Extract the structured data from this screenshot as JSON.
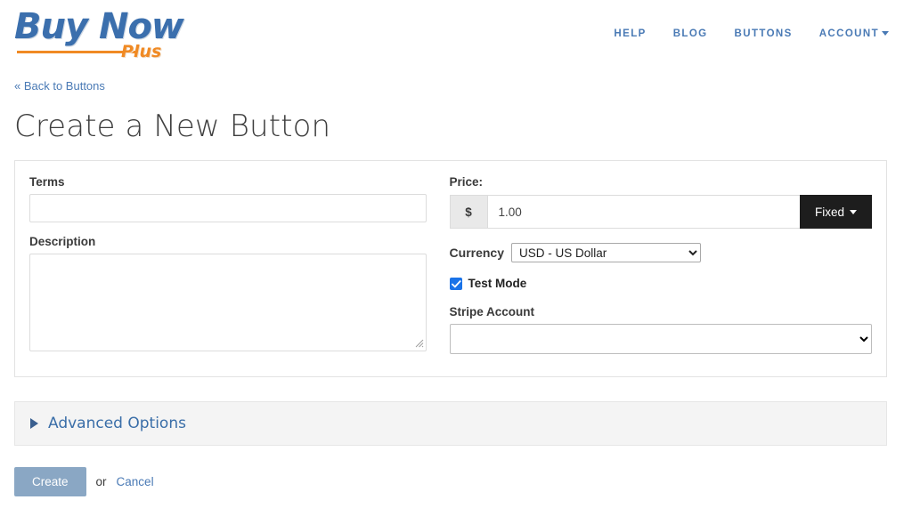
{
  "header": {
    "logo": {
      "main": "Buy Now",
      "sub": "Plus"
    },
    "nav": [
      {
        "label": "HELP",
        "has_caret": false
      },
      {
        "label": "BLOG",
        "has_caret": false
      },
      {
        "label": "BUTTONS",
        "has_caret": false
      },
      {
        "label": "ACCOUNT",
        "has_caret": true
      }
    ]
  },
  "page": {
    "back_link": "« Back to Buttons",
    "title": "Create a New Button"
  },
  "form": {
    "terms": {
      "label": "Terms",
      "value": "",
      "placeholder": ""
    },
    "description": {
      "label": "Description",
      "value": "",
      "placeholder": ""
    },
    "price": {
      "label": "Price:",
      "currency_symbol": "$",
      "value": "1.00",
      "placeholder": "",
      "type_button": "Fixed"
    },
    "currency": {
      "label": "Currency",
      "selected": "USD - US Dollar",
      "options": [
        "USD - US Dollar"
      ]
    },
    "test_mode": {
      "label": "Test Mode",
      "checked": true
    },
    "stripe_account": {
      "label": "Stripe Account",
      "selected": "",
      "options": [
        ""
      ]
    }
  },
  "advanced": {
    "label": "Advanced Options",
    "expanded": false
  },
  "actions": {
    "create_label": "Create",
    "or_label": "or",
    "cancel_label": "Cancel"
  },
  "colors": {
    "brand_blue": "#3b6fad",
    "brand_orange": "#f08a24",
    "link_blue": "#4a7ab5",
    "checkbox_blue": "#1a73e8",
    "dark_button": "#1d1d1d",
    "create_button": "#8aa7c4"
  }
}
